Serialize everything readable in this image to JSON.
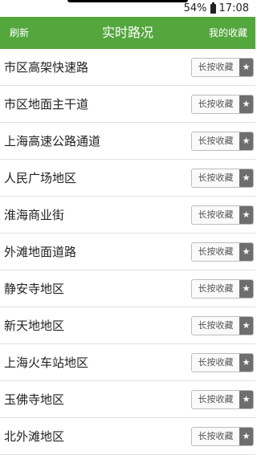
{
  "status_bar": {
    "battery": "54%",
    "time": "17:08"
  },
  "header": {
    "left_label": "刷新",
    "title": "实时路况",
    "right_label": "我的收藏"
  },
  "favorite_button_label": "长按收藏",
  "rows": [
    {
      "name": "市区高架快速路"
    },
    {
      "name": "市区地面主干道"
    },
    {
      "name": "上海高速公路通道"
    },
    {
      "name": "人民广场地区"
    },
    {
      "name": "淮海商业街"
    },
    {
      "name": "外滩地面道路"
    },
    {
      "name": "静安寺地区"
    },
    {
      "name": "新天地地区"
    },
    {
      "name": "上海火车站地区"
    },
    {
      "name": "玉佛寺地区"
    },
    {
      "name": "北外滩地区"
    }
  ],
  "colors": {
    "header_bg": "#53a73d",
    "header_text": "#ffffff"
  }
}
